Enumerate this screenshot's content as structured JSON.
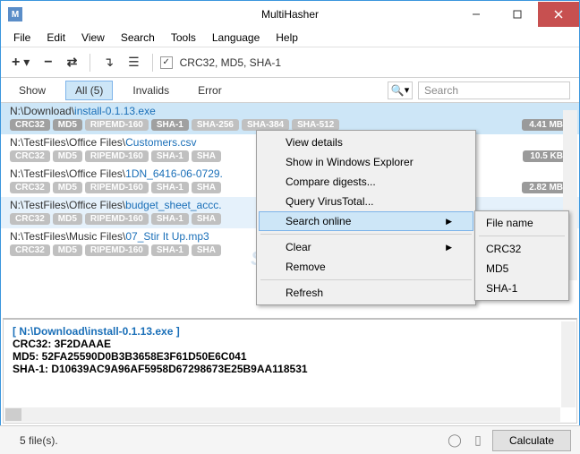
{
  "window": {
    "title": "MultiHasher",
    "icon_letter": "M"
  },
  "menubar": [
    "File",
    "Edit",
    "View",
    "Search",
    "Tools",
    "Language",
    "Help"
  ],
  "toolbar": {
    "hash_types": "CRC32, MD5, SHA-1"
  },
  "filterbar": {
    "show_label": "Show",
    "all": "All (5)",
    "invalids": "Invalids",
    "error": "Error",
    "search_placeholder": "Search"
  },
  "files": [
    {
      "path_prefix": "N:\\Download\\",
      "name": "install-0.1.13.exe",
      "size": "4.41 MB",
      "badges": [
        "CRC32",
        "MD5",
        "RIPEMD-160",
        "SHA-1",
        "SHA-256",
        "SHA-384",
        "SHA-512"
      ]
    },
    {
      "path_prefix": "N:\\TestFiles\\Office Files\\",
      "name": "Customers.csv",
      "size": "10.5 KB",
      "badges": [
        "CRC32",
        "MD5",
        "RIPEMD-160",
        "SHA-1",
        "SHA"
      ]
    },
    {
      "path_prefix": "N:\\TestFiles\\Office Files\\",
      "name": "1DN_6416-06-0729.",
      "size": "2.82 MB",
      "badges": [
        "CRC32",
        "MD5",
        "RIPEMD-160",
        "SHA-1",
        "SHA"
      ]
    },
    {
      "path_prefix": "N:\\TestFiles\\Office Files\\",
      "name": "budget_sheet_accc.",
      "size": "",
      "badges": [
        "CRC32",
        "MD5",
        "RIPEMD-160",
        "SHA-1",
        "SHA"
      ]
    },
    {
      "path_prefix": "N:\\TestFiles\\Music Files\\",
      "name": "07_Stir It Up.mp3",
      "size": "",
      "badges": [
        "CRC32",
        "MD5",
        "RIPEMD-160",
        "SHA-1",
        "SHA"
      ]
    }
  ],
  "context_menu": {
    "view_details": "View details",
    "show_explorer": "Show in Windows Explorer",
    "compare": "Compare digests...",
    "query_vt": "Query VirusTotal...",
    "search_online": "Search online",
    "clear": "Clear",
    "remove": "Remove",
    "refresh": "Refresh"
  },
  "submenu": {
    "filename": "File name",
    "crc32": "CRC32",
    "md5": "MD5",
    "sha1": "SHA-1"
  },
  "details": {
    "header": "[ N:\\Download\\install-0.1.13.exe ]",
    "crc32": "CRC32: 3F2DAAAE",
    "md5": "MD5: 52FA25590D0B3B3658E3F61D50E6C041",
    "sha1": "SHA-1: D10639AC9A96AF5958D67298673E25B9AA118531"
  },
  "statusbar": {
    "text": "5 file(s).",
    "calculate": "Calculate"
  },
  "watermark": "SnapFiles"
}
